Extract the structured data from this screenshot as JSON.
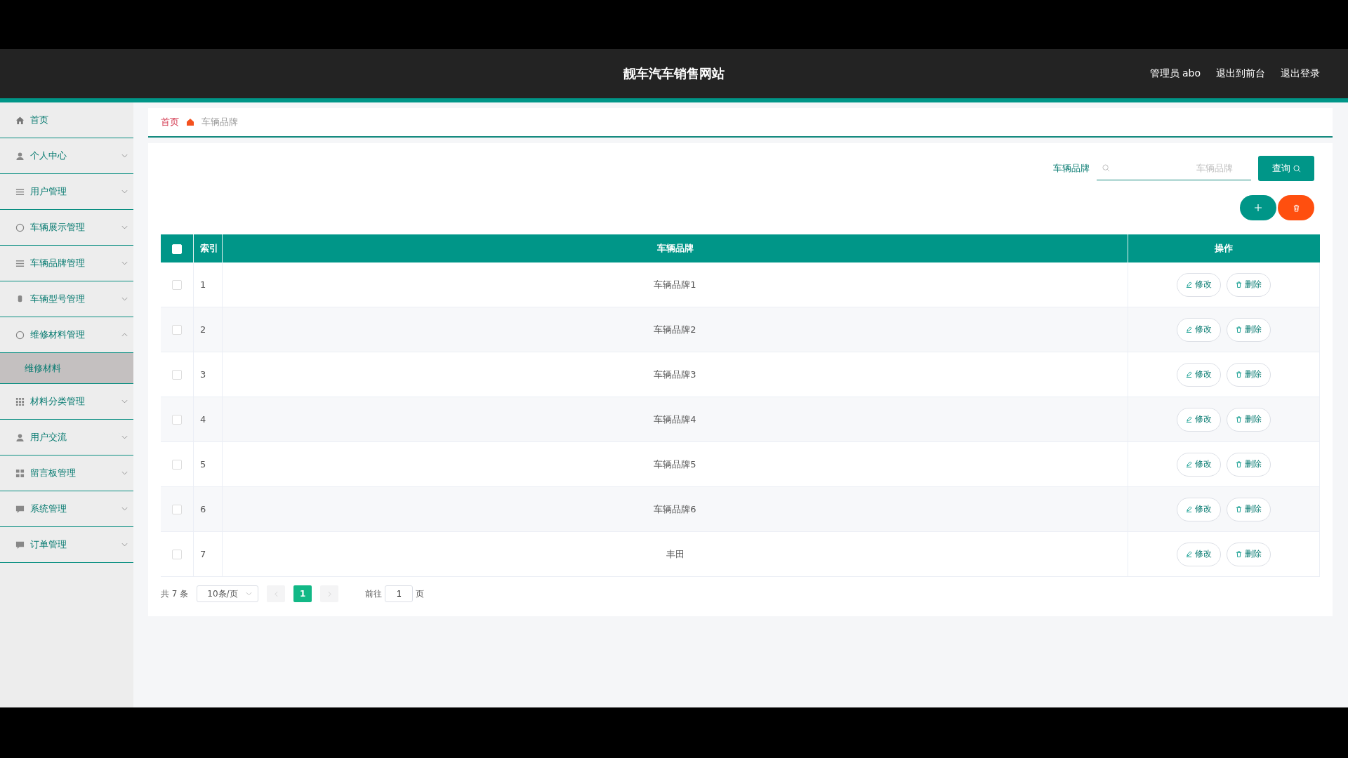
{
  "header": {
    "title": "靓车汽车销售网站",
    "user": "管理员 abo",
    "links": [
      "退出到前台",
      "退出登录"
    ]
  },
  "sidebar": {
    "items": [
      {
        "label": "首页",
        "kind": "link"
      },
      {
        "label": "个人中心",
        "kind": "menu",
        "expanded": false
      },
      {
        "label": "用户管理",
        "kind": "menu",
        "expanded": false
      },
      {
        "label": "车辆展示管理",
        "kind": "menu",
        "expanded": false
      },
      {
        "label": "车辆品牌管理",
        "kind": "menu",
        "expanded": false
      },
      {
        "label": "车辆型号管理",
        "kind": "menu",
        "expanded": false
      },
      {
        "label": "维修材料管理",
        "kind": "menu",
        "expanded": true,
        "children": [
          {
            "label": "维修材料",
            "selected": true
          }
        ]
      },
      {
        "label": "材料分类管理",
        "kind": "menu",
        "expanded": false
      },
      {
        "label": "用户交流",
        "kind": "menu",
        "expanded": false
      },
      {
        "label": "留言板管理",
        "kind": "menu",
        "expanded": false
      },
      {
        "label": "系统管理",
        "kind": "menu",
        "expanded": false
      },
      {
        "label": "订单管理",
        "kind": "menu",
        "expanded": false
      }
    ]
  },
  "breadcrumb": [
    "首页",
    "车辆品牌"
  ],
  "search": {
    "label": "车辆品牌",
    "placeholder": "车辆品牌",
    "button": "查询"
  },
  "table": {
    "select_all": {
      "checked": false
    },
    "columns": [
      "索引",
      "车辆品牌",
      "操作"
    ],
    "rows": [
      {
        "checked": false,
        "index": "1",
        "brand": "车辆品牌1",
        "actions": [
          "修改",
          "删除"
        ]
      },
      {
        "checked": false,
        "index": "2",
        "brand": "车辆品牌2",
        "actions": [
          "修改",
          "删除"
        ]
      },
      {
        "checked": false,
        "index": "3",
        "brand": "车辆品牌3",
        "actions": [
          "修改",
          "删除"
        ]
      },
      {
        "checked": false,
        "index": "4",
        "brand": "车辆品牌4",
        "actions": [
          "修改",
          "删除"
        ]
      },
      {
        "checked": false,
        "index": "5",
        "brand": "车辆品牌5",
        "actions": [
          "修改",
          "删除"
        ]
      },
      {
        "checked": false,
        "index": "6",
        "brand": "车辆品牌6",
        "actions": [
          "修改",
          "删除"
        ]
      },
      {
        "checked": false,
        "index": "7",
        "brand": "丰田",
        "actions": [
          "修改",
          "删除"
        ]
      }
    ]
  },
  "pagination": {
    "total": "共 7 条",
    "page_size": "10条/页",
    "pages": [
      {
        "label": "1",
        "selected": true
      }
    ],
    "goto_label": "前往",
    "goto_value": "1",
    "goto_suffix": "页"
  }
}
